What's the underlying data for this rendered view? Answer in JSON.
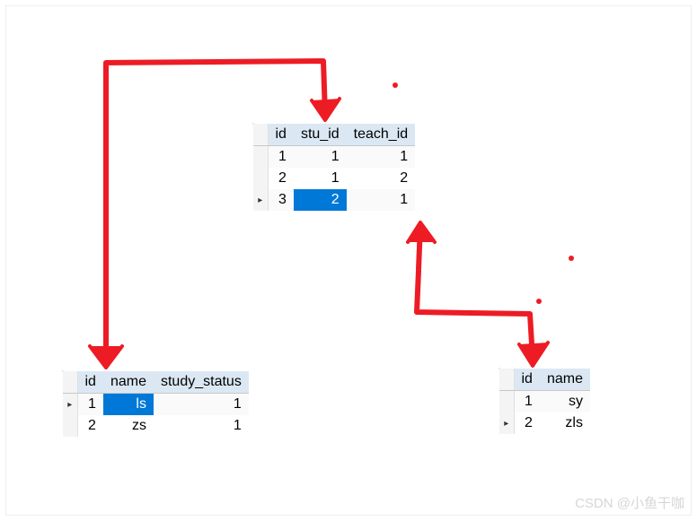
{
  "tables": {
    "junction": {
      "columns": [
        "id",
        "stu_id",
        "teach_id"
      ],
      "rows": [
        {
          "marker": "",
          "cells": [
            "1",
            "1",
            "1"
          ],
          "selected": []
        },
        {
          "marker": "",
          "cells": [
            "2",
            "1",
            "2"
          ],
          "selected": []
        },
        {
          "marker": "▸",
          "cells": [
            "3",
            "2",
            "1"
          ],
          "selected": [
            1
          ]
        }
      ]
    },
    "student": {
      "columns": [
        "id",
        "name",
        "study_status"
      ],
      "rows": [
        {
          "marker": "▸",
          "cells": [
            "1",
            "ls",
            "1"
          ],
          "selected": [
            1
          ]
        },
        {
          "marker": "",
          "cells": [
            "2",
            "zs",
            "1"
          ],
          "selected": []
        }
      ]
    },
    "teacher": {
      "columns": [
        "id",
        "name"
      ],
      "rows": [
        {
          "marker": "",
          "cells": [
            "1",
            "sy"
          ],
          "selected": []
        },
        {
          "marker": "▸",
          "cells": [
            "2",
            "zls"
          ],
          "selected": []
        }
      ]
    }
  },
  "watermark": "CSDN @小鱼干咖",
  "diagram": {
    "annotations": "hand-drawn red arrows linking junction.stu_id → student table and junction.teach_id → teacher table",
    "color": "#ed1c24"
  }
}
